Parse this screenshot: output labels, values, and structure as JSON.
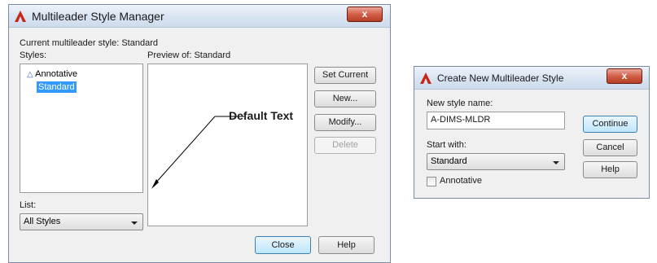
{
  "manager": {
    "title": "Multileader Style Manager",
    "current_style_label": "Current multileader style: Standard",
    "styles_label": "Styles:",
    "styles": [
      "Annotative",
      "Standard"
    ],
    "preview_label": "Preview of: Standard",
    "preview_text": "Default Text",
    "list_label": "List:",
    "list_value": "All Styles",
    "buttons": {
      "set_current": "Set Current",
      "new": "New...",
      "modify": "Modify...",
      "delete": "Delete",
      "close": "Close",
      "help": "Help"
    },
    "close_glyph": "x"
  },
  "create_new": {
    "title": "Create New Multileader Style",
    "new_style_label": "New style name:",
    "new_style_value": "A-DIMS-MLDR",
    "start_with_label": "Start with:",
    "start_with_value": "Standard",
    "annotative_label": "Annotative",
    "annotative_checked": false,
    "buttons": {
      "continue": "Continue",
      "cancel": "Cancel",
      "help": "Help"
    },
    "close_glyph": "x"
  },
  "colors": {
    "selection": "#3399ff",
    "autocad_red": "#c8261b",
    "close_button": "#c8462d"
  }
}
